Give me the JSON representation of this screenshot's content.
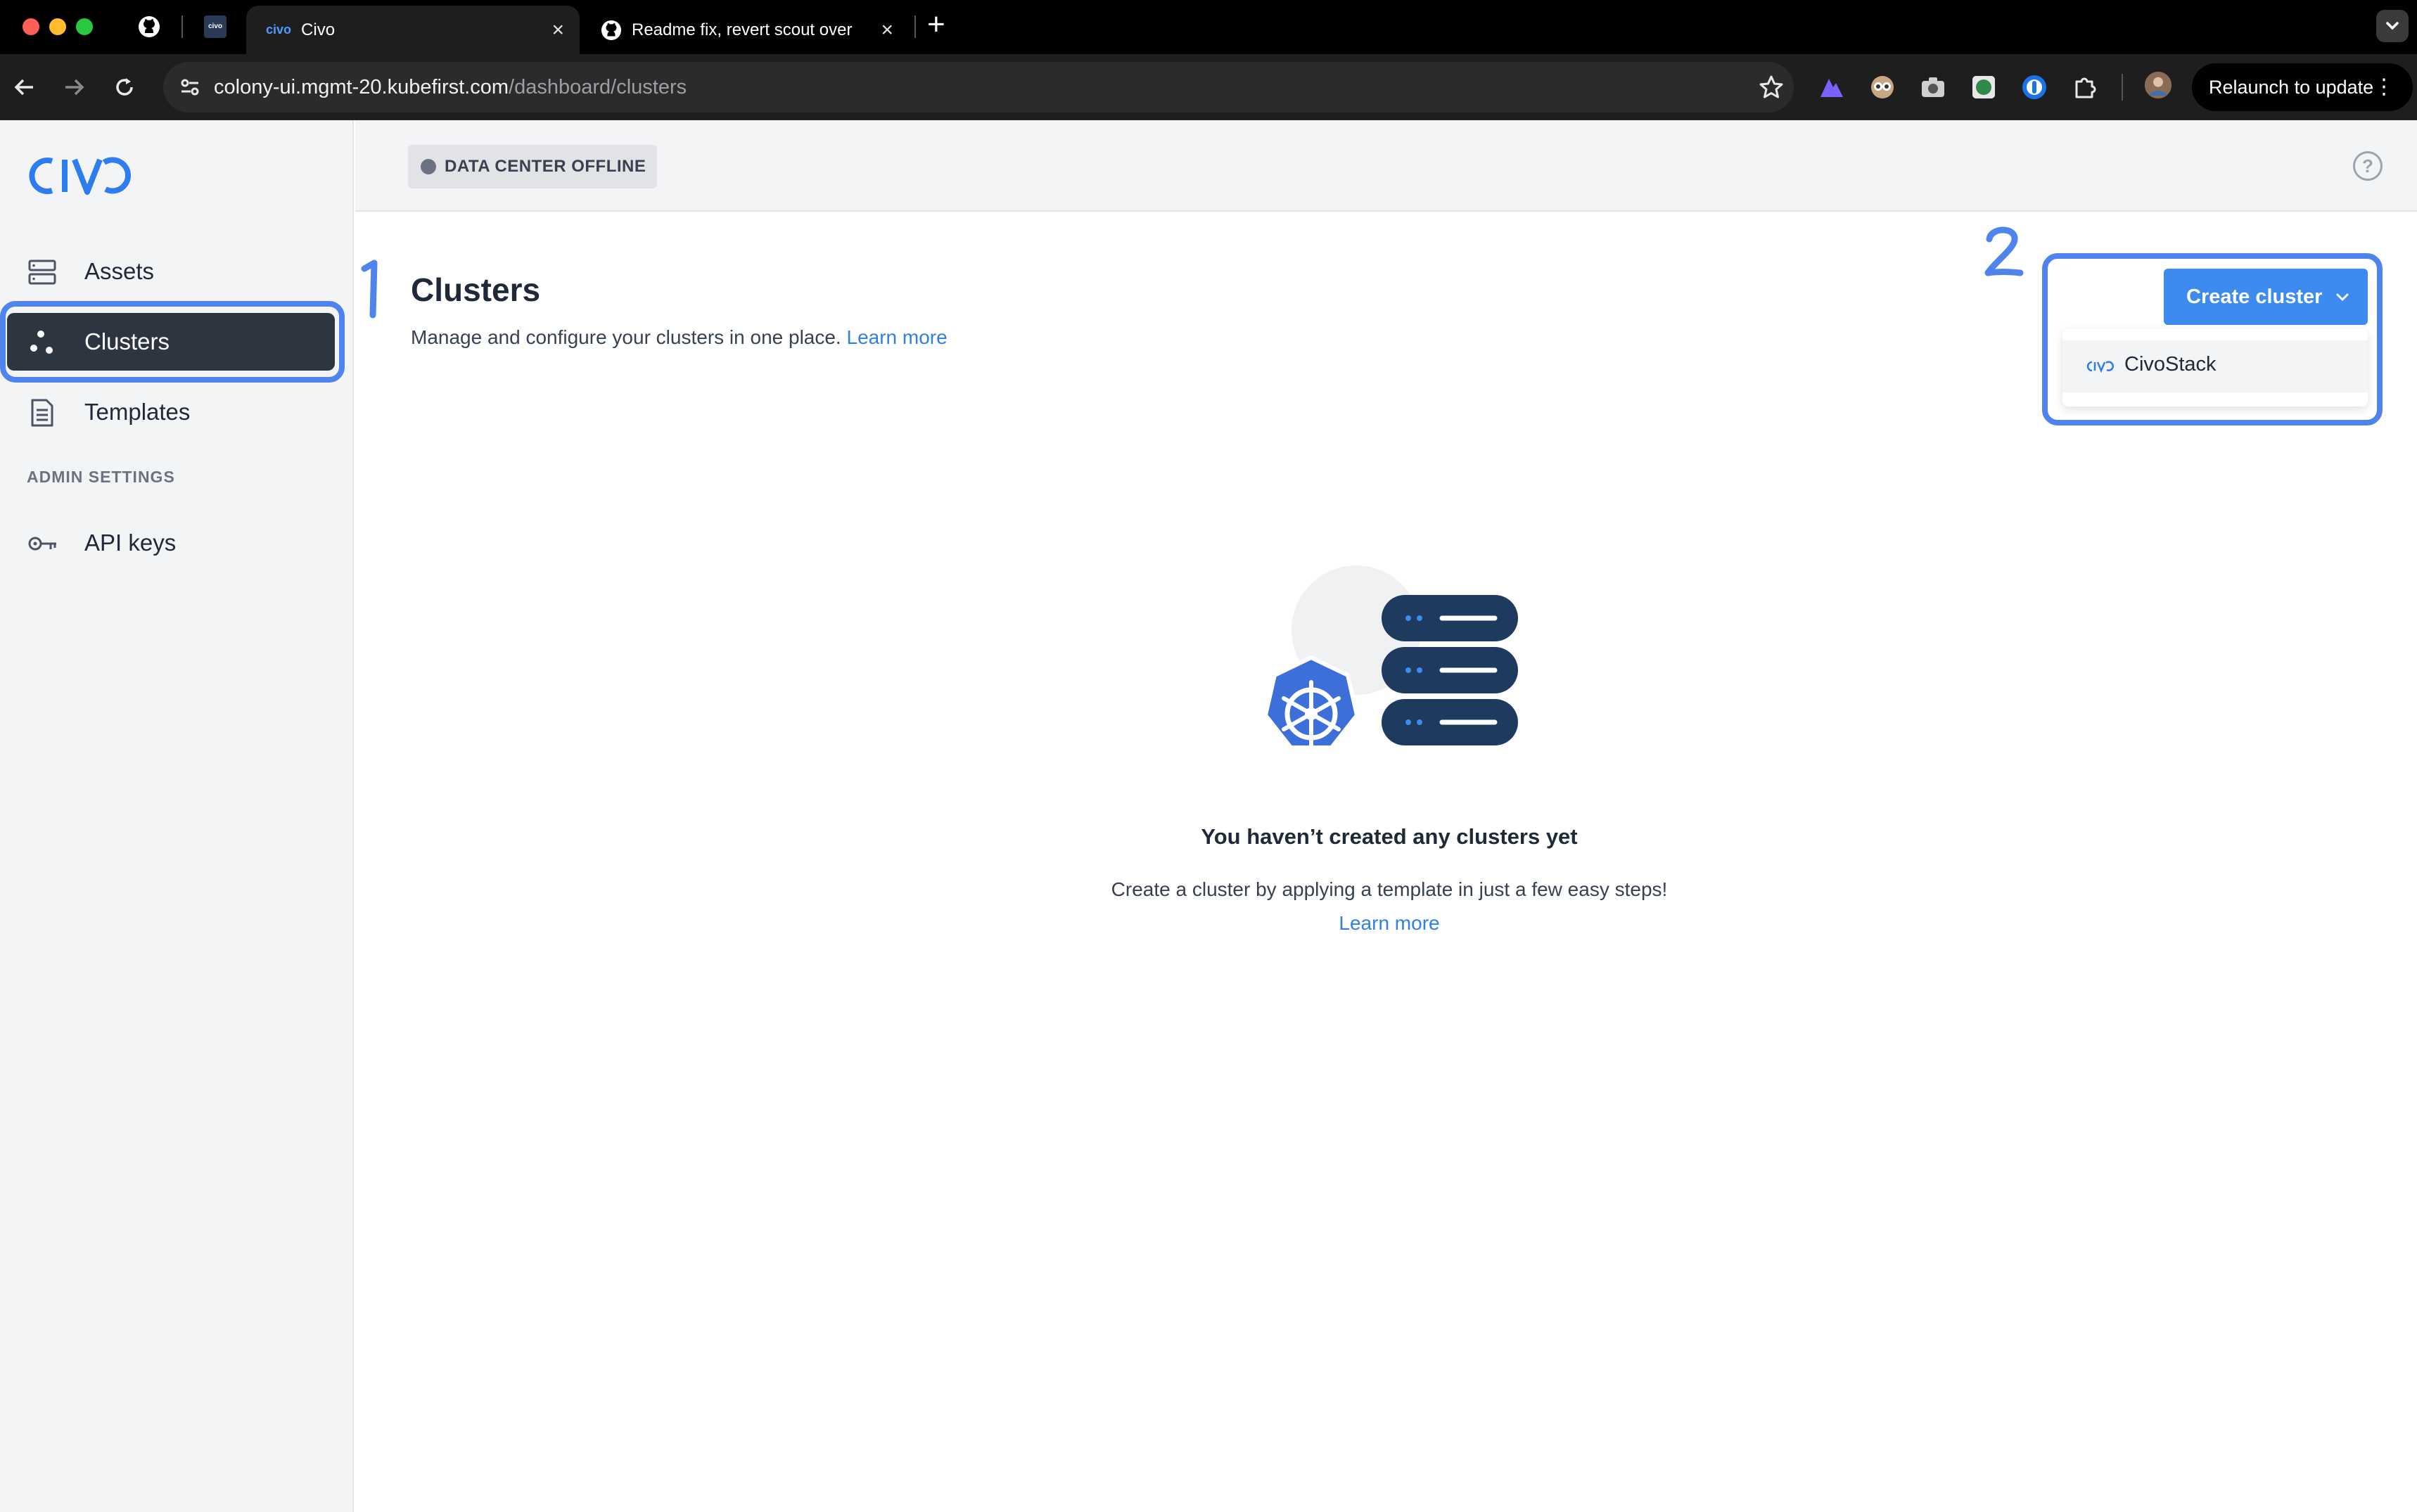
{
  "browser": {
    "tabs": [
      {
        "title": "Civo",
        "active": true
      },
      {
        "title": "Readme fix, revert scout over",
        "active": false
      }
    ],
    "url_host": "colony-ui.mgmt-20.kubefirst.com",
    "url_path": "/dashboard/clusters",
    "relaunch_label": "Relaunch to update",
    "new_tab_label": "+"
  },
  "sidebar": {
    "items": [
      {
        "label": "Assets",
        "icon": "server-icon"
      },
      {
        "label": "Clusters",
        "icon": "cluster-icon",
        "selected": true
      },
      {
        "label": "Templates",
        "icon": "document-icon"
      }
    ],
    "admin_heading": "ADMIN SETTINGS",
    "admin_items": [
      {
        "label": "API keys",
        "icon": "key-icon"
      }
    ]
  },
  "topbar": {
    "status_badge": "DATA CENTER OFFLINE"
  },
  "page": {
    "title": "Clusters",
    "subtitle": "Manage and configure your clusters in one place.",
    "subtitle_link": "Learn more"
  },
  "create": {
    "button_label": "Create cluster",
    "dropdown_items": [
      {
        "label": "CivoStack"
      }
    ]
  },
  "empty_state": {
    "title": "You haven’t created any clusters yet",
    "subtitle": "Create a cluster by applying a template in just a few easy steps!",
    "link": "Learn more"
  },
  "annotations": {
    "first": "1",
    "second": "2"
  },
  "colors": {
    "accent": "#3d8bef",
    "highlight": "#4f83ee",
    "link": "#2f80e6",
    "sidebar_selected": "#2c3540",
    "illustration_dark": "#1e3a5f",
    "kubernetes_blue": "#3c6fd9"
  }
}
